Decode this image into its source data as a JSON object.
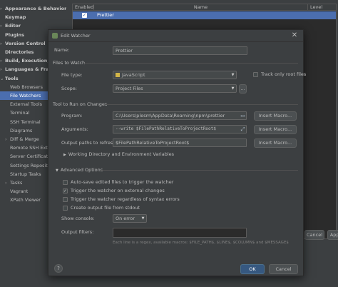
{
  "settings_tree": {
    "items": [
      {
        "label": "Appearance & Behavior",
        "kind": "top",
        "arrow": "›"
      },
      {
        "label": "Keymap",
        "kind": "top",
        "arrow": ""
      },
      {
        "label": "Editor",
        "kind": "top",
        "arrow": "›"
      },
      {
        "label": "Plugins",
        "kind": "top",
        "arrow": ""
      },
      {
        "label": "Version Control",
        "kind": "top",
        "arrow": "›"
      },
      {
        "label": "Directories",
        "kind": "top",
        "arrow": ""
      },
      {
        "label": "Build, Execution, Deploy",
        "kind": "top",
        "arrow": "›"
      },
      {
        "label": "Languages & Framewor",
        "kind": "top",
        "arrow": "›"
      },
      {
        "label": "Tools",
        "kind": "top",
        "arrow": "⌄"
      },
      {
        "label": "Web Browsers",
        "kind": "child",
        "arrow": ""
      },
      {
        "label": "File Watchers",
        "kind": "child",
        "arrow": "",
        "selected": true
      },
      {
        "label": "External Tools",
        "kind": "child",
        "arrow": ""
      },
      {
        "label": "Terminal",
        "kind": "child",
        "arrow": ""
      },
      {
        "label": "SSH Terminal",
        "kind": "child",
        "arrow": ""
      },
      {
        "label": "Diagrams",
        "kind": "child",
        "arrow": ""
      },
      {
        "label": "Diff & Merge",
        "kind": "child",
        "arrow": "›"
      },
      {
        "label": "Remote SSH External T",
        "kind": "child",
        "arrow": ""
      },
      {
        "label": "Server Certificates",
        "kind": "child",
        "arrow": ""
      },
      {
        "label": "Settings Repository",
        "kind": "child",
        "arrow": ""
      },
      {
        "label": "Startup Tasks",
        "kind": "child",
        "arrow": ""
      },
      {
        "label": "Tasks",
        "kind": "child",
        "arrow": "›"
      },
      {
        "label": "Vagrant",
        "kind": "child",
        "arrow": ""
      },
      {
        "label": "XPath Viewer",
        "kind": "child",
        "arrow": ""
      }
    ]
  },
  "watcher_table": {
    "headers": {
      "enabled": "Enabled",
      "name": "Name",
      "level": "Level"
    },
    "rows": [
      {
        "enabled": true,
        "name": "Prettier"
      }
    ]
  },
  "settings_buttons": {
    "cancel": "Cancel",
    "apply": "Apply"
  },
  "dialog": {
    "title": "Edit Watcher",
    "close_glyph": "✕",
    "name_label": "Name:",
    "name_value": "Prettier",
    "files_section": "Files to Watch",
    "file_type_label": "File type:",
    "file_type_value": "JavaScript",
    "track_only_root_label": "Track only root files",
    "track_only_root_checked": false,
    "scope_label": "Scope:",
    "scope_value": "Project Files",
    "scope_more": "...",
    "tool_section": "Tool to Run on Changes",
    "program_label": "Program:",
    "program_value": "C:\\Users\\plesm\\AppData\\Roaming\\npm\\prettier",
    "arguments_label": "Arguments:",
    "arguments_value": "--write $FilePathRelativeToProjectRoot$",
    "output_label": "Output paths to refresh:",
    "output_value": "$FilePathRelativeToProjectRoot$",
    "insert_macro": "Insert Macro...",
    "working_dir_label": "Working Directory and Environment Variables",
    "advanced_section": "Advanced Options",
    "options": [
      {
        "label": "Auto-save edited files to trigger the watcher",
        "checked": false
      },
      {
        "label": "Trigger the watcher on external changes",
        "checked": true
      },
      {
        "label": "Trigger the watcher regardless of syntax errors",
        "checked": false
      },
      {
        "label": "Create output file from stdout",
        "checked": false
      }
    ],
    "show_console_label": "Show console:",
    "show_console_value": "On error",
    "output_filters_label": "Output filters:",
    "output_filters_hint": "Each line is a regex, available macros: $FILE_PATH$, $LINE$, $COLUMN$ and $MESSAGE$",
    "help": "?",
    "ok": "OK",
    "cancel": "Cancel"
  }
}
